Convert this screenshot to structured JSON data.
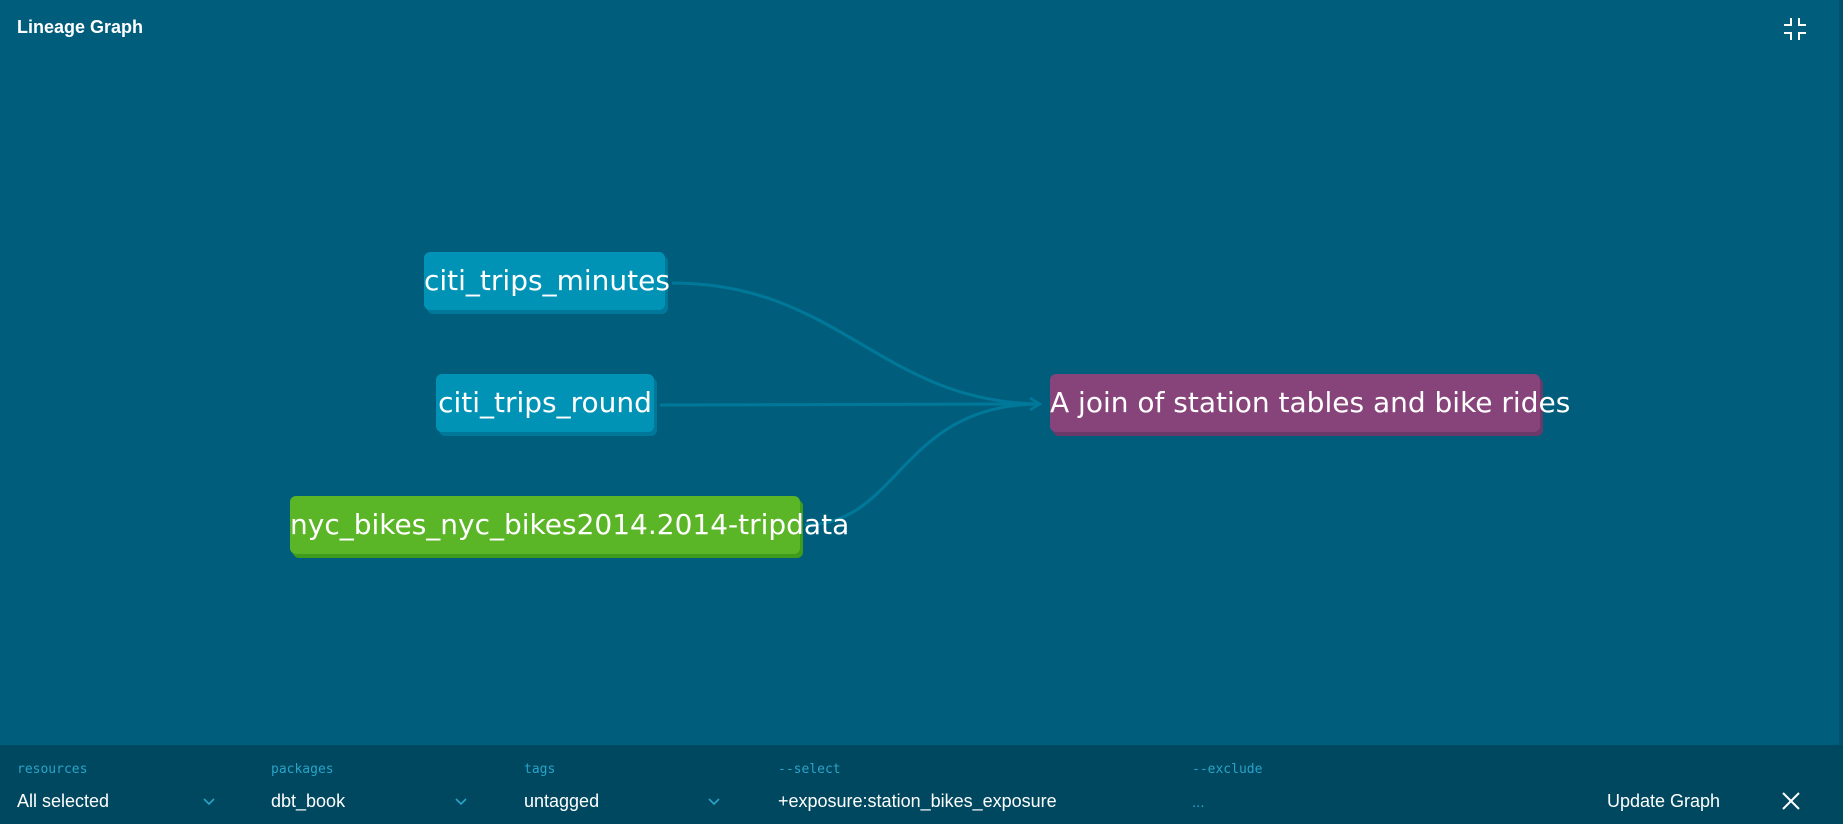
{
  "header": {
    "title": "Lineage Graph",
    "collapse_icon": "collapse-arrows-icon"
  },
  "graph": {
    "nodes": [
      {
        "label": "citi_trips_minutes",
        "type": "model"
      },
      {
        "label": "citi_trips_round",
        "type": "model"
      },
      {
        "label": "nyc_bikes_nyc_bikes2014.2014-tripdata",
        "type": "source"
      },
      {
        "label": "A join of station tables and bike rides",
        "type": "exposure"
      }
    ],
    "colors": {
      "background": "#005e7c",
      "model": "#0093b6",
      "source": "#5bb627",
      "exposure": "#87447a",
      "edge": "#00789a"
    }
  },
  "toolbar": {
    "resources": {
      "label": "resources",
      "value": "All selected"
    },
    "packages": {
      "label": "packages",
      "value": "dbt_book"
    },
    "tags": {
      "label": "tags",
      "value": "untagged"
    },
    "select": {
      "label": "--select",
      "value": "+exposure:station_bikes_exposure"
    },
    "exclude": {
      "label": "--exclude",
      "value": "..."
    },
    "update_label": "Update Graph",
    "close_icon": "close-icon"
  }
}
